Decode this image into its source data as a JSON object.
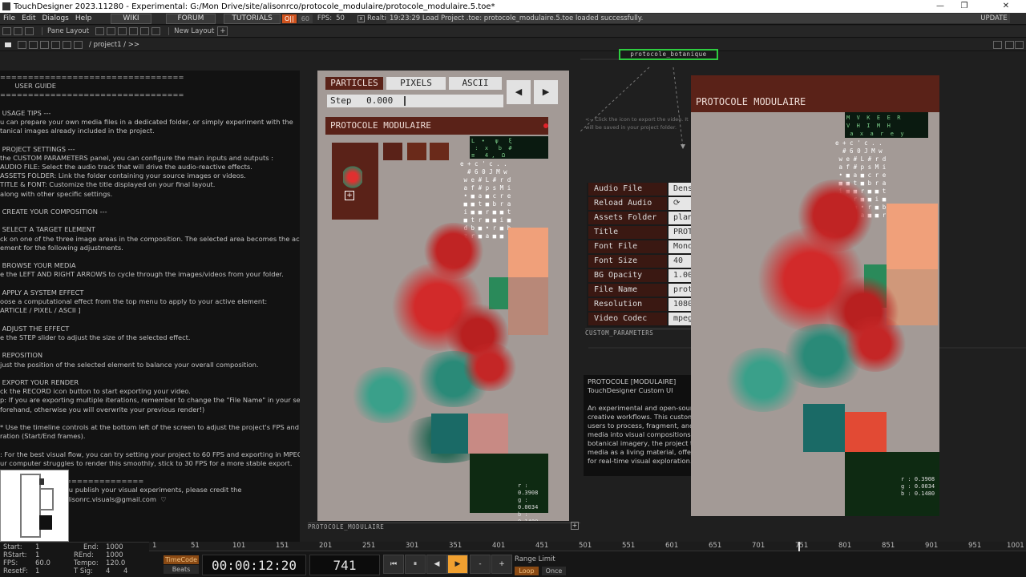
{
  "window": {
    "title": "TouchDesigner 2023.11280 - Experimental: G:/Mon Drive/site/alisonrco/protocole_modulaire/protocole_modulaire.5.toe*",
    "controls": [
      "—",
      "❐",
      "✕"
    ]
  },
  "menubar": {
    "items": [
      "File",
      "Edit",
      "Dialogs",
      "Help"
    ],
    "buttons": [
      "WIKI",
      "FORUM",
      "TUTORIALS"
    ],
    "chip_a": "O||",
    "chip_b": "60",
    "fps_label": "FPS:",
    "fps_value": "50",
    "realtime_label": "Realtime",
    "status": "19:23:29 Load Project .toe: protocole_modulaire.5.toe loaded successfully.",
    "update": "UPDATE"
  },
  "panebar": {
    "pane_layout": "Pane Layout",
    "new_layout": "New Layout",
    "plus": "+"
  },
  "pathbar": {
    "path": "/ project1 / >>"
  },
  "guide": {
    "text": "=================================\n       USER GUIDE\n=================================\n\n USAGE TIPS ---\nu can prepare your own media files in a dedicated folder, or simply experiment with the\ntanical images already included in the project.\n\n PROJECT SETTINGS ---\nthe CUSTOM PARAMETERS panel, you can configure the main inputs and outputs :\nAUDIO FILE: Select the audio track that will drive the audio-reactive effects.\nASSETS FOLDER: Link the folder containing your source images or videos.\nTITLE & FONT: Customize the title displayed on your final layout.\nalong with other specific settings.\n\n CREATE YOUR COMPOSITION ---\n\n SELECT A TARGET ELEMENT\nck on one of the three image areas in the composition. The selected area becomes the active\nement for the following adjustments.\n\n BROWSE YOUR MEDIA\ne the LEFT AND RIGHT ARROWS to cycle through the images/videos from your folder.\n\n APPLY A SYSTEM EFFECT\noose a computational effect from the top menu to apply to your active element:\nARTICLE / PIXEL / ASCII ]\n\n ADJUST THE EFFECT\ne the STEP slider to adjust the size of the selected effect.\n\n REPOSITION\njust the position of the selected element to balance your overall composition.\n\n EXPORT YOUR RENDER\nck the RECORD icon button to start exporting your video.\np: If you are exporting multiple iterations, remember to change the \"File Name\" in your settings\nforehand, otherwise you will overwrite your previous render!)\n\n* Use the timeline controls at the bottom left of the screen to adjust the project's FPS and\nration (Start/End frames).\n\n: For the best visual flow, you can try setting your project to 60 FPS and exporting in MPEG4. If\nur computer struggles to render this smoothly, stick to 30 FPS for a more stable export.\n\n          ======================\n          nd share. If you publish your visual experiments, please credit the\n          end them to alisonrc.visuals@gmail.com  ♡\n\n          ghts reserved."
  },
  "center": {
    "tabs": [
      "PARTICLES",
      "PIXELS",
      "ASCII"
    ],
    "prev": "◀",
    "next": "▶",
    "step_label": "Step",
    "step_value": "0.000",
    "title": "PROTOCOLE MODULAIRE",
    "node_label": "PROTOCOLE_MODULAIRE",
    "readout": [
      "r : 0.3908",
      "g : 0.0034",
      "b : 0.1480"
    ],
    "ascii_top": "L  •   ψ   ξ\n :  x   b  #\n≡   4 ,  Ω",
    "right_ascii": "e + c ' c . .\n  # 6 0 J M w\n w e # L # r d\n a f # p s M i\n • ■ a ■ c r e\n ■ ■ t ■ b r a\n i ■ ■ r ■ ■ t\n ■ t r ■ ■ i ■\n d b ■ • r ■ b\n z r ■ a ■ ■ r"
  },
  "node_botanique": "protocole_botanique",
  "export_hint": "<-- Click the icon to export the video. It will be saved in your project folder.",
  "right": {
    "title": "PROTOCOLE MODULAIRE",
    "readout": [
      "r : 0.3908",
      "g : 0.0034",
      "b : 0.1480"
    ],
    "ascii_top": "M  V  K  E  E  R\nV  H  I  M  H\n a  x  a  r  e  y"
  },
  "params": {
    "rows": [
      {
        "k": "Audio File",
        "v": "Dens"
      },
      {
        "k": "Reload Audio",
        "v": "⟳"
      },
      {
        "k": "Assets Folder",
        "v": "plan"
      },
      {
        "k": "Title",
        "v": "PROT"
      },
      {
        "k": "Font File",
        "v": "Mono"
      },
      {
        "k": "Font Size",
        "v": "40"
      },
      {
        "k": "BG Opacity",
        "v": "1.00"
      },
      {
        "k": "File Name",
        "v": "prot"
      },
      {
        "k": "Resolution",
        "v": "1080"
      },
      {
        "k": "Video Codec",
        "v": "mpeg"
      }
    ],
    "label": "CUSTOM_PARAMETERS"
  },
  "info": {
    "text": "PROTOCOLE [MODULAIRE]\nTouchDesigner Custom UI\n\nAn experimental and open-sourc\ncreative workflows. This custom c\nusers to process, fragment, and t\nmedia into visual compositions. C\nbotanical imagery, the project tre\nmedia as a living material, offerin\nfor real-time visual exploration."
  },
  "timeline": {
    "ruler": [
      "1",
      "51",
      "101",
      "151",
      "201",
      "251",
      "301",
      "351",
      "401",
      "451",
      "501",
      "551",
      "601",
      "651",
      "701",
      "751",
      "801",
      "851",
      "901",
      "951",
      "1001"
    ],
    "labels": {
      "start": "Start:",
      "start_v": "1",
      "end": "End:",
      "end_v": "1000",
      "rstart": "RStart:",
      "rstart_v": "1",
      "rend": "REnd:",
      "rend_v": "1000",
      "fps": "FPS:",
      "fps_v": "60.0",
      "tempo": "Tempo:",
      "tempo_v": "120.0",
      "resetf": "ResetF:",
      "resetf_v": "1",
      "tsig": "T Sig:",
      "tsig_a": "4",
      "tsig_b": "4"
    },
    "timecode": "TimeCode",
    "beats": "Beats",
    "time": "00:00:12:20",
    "frame": "741",
    "buttons": [
      "⏮",
      "⏸",
      "◀",
      "▶",
      "-",
      "+"
    ],
    "range_limit": "Range Limit",
    "loop": "Loop",
    "once": "Once"
  },
  "colors": {
    "accent_dark": "#5a2218",
    "panel_bg": "#a39a96",
    "orange": "#f0a07a",
    "play": "#f0a030"
  }
}
